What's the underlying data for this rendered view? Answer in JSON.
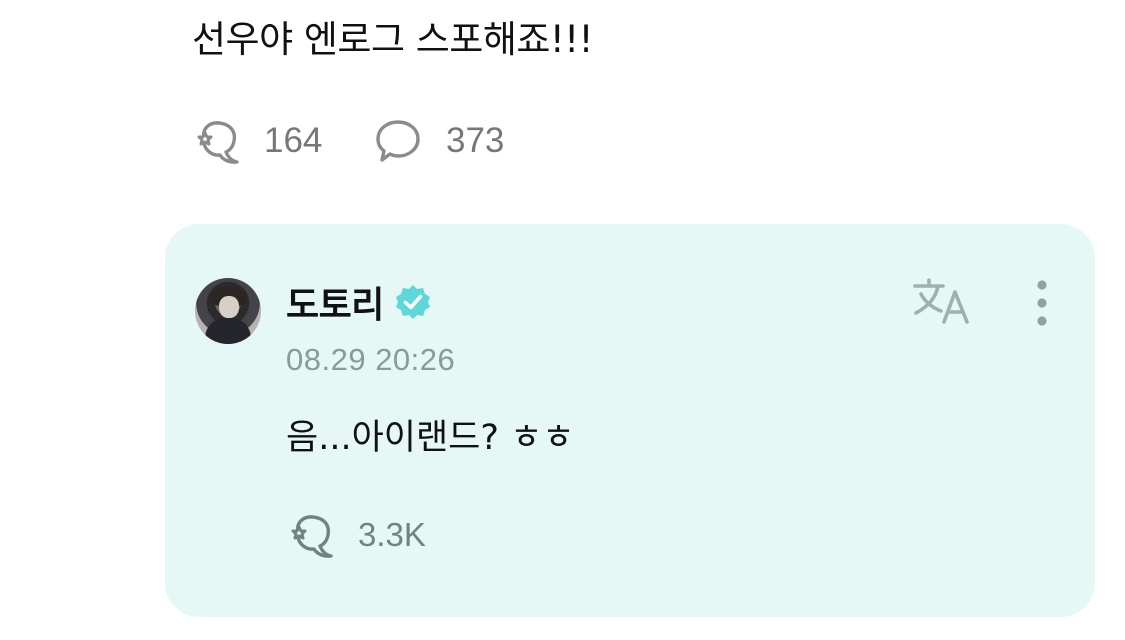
{
  "post": {
    "text": "선우야 엔로그 스포해죠!!!",
    "like_icon": "bubble-star-icon",
    "like_count": "164",
    "comment_icon": "chat-bubble-icon",
    "comment_count": "373"
  },
  "reply": {
    "author": "도토리",
    "verified_icon": "verified-badge-icon",
    "timestamp": "08.29 20:26",
    "text": "음...아이랜드? ㅎㅎ",
    "translate_icon": "translate-icon",
    "more_icon": "more-vertical-icon",
    "like_count": "3.3K"
  },
  "colors": {
    "card_background": "#e6f8f6",
    "verified_badge": "#5fd6d8",
    "muted_text": "#8a9a98",
    "icon_gray": "#8b8b8b",
    "reply_icon": "#6f8381"
  }
}
